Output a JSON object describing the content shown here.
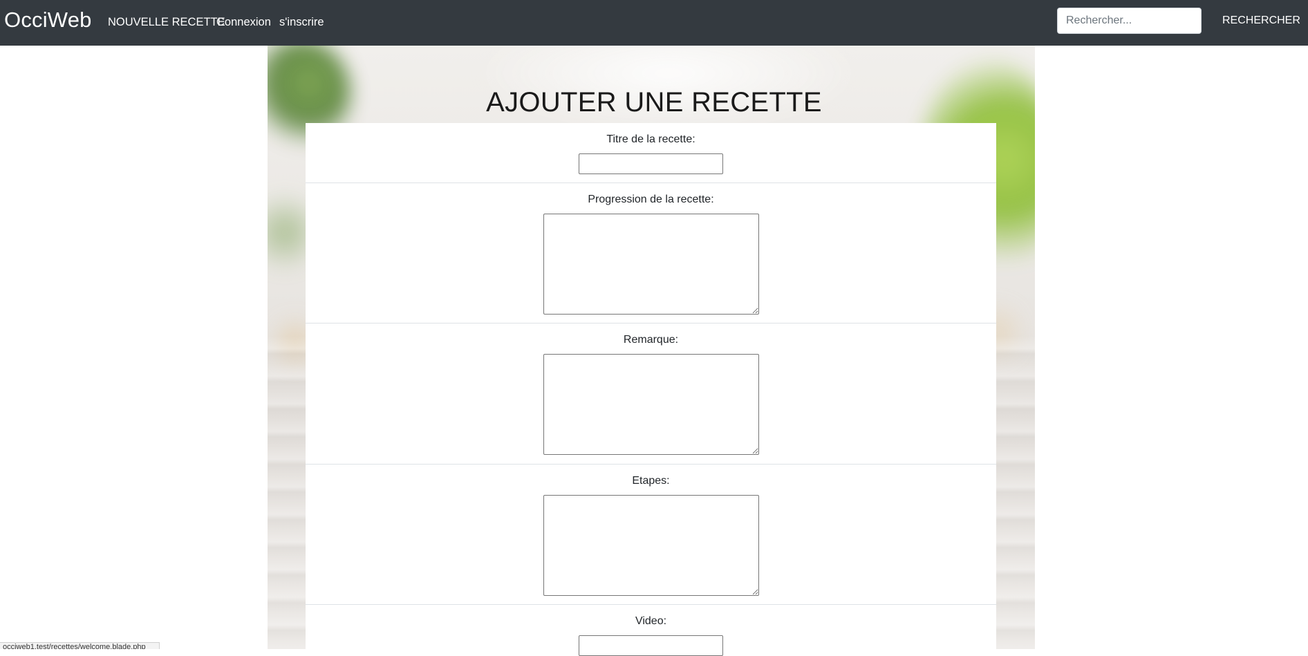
{
  "navbar": {
    "brand": "OcciWeb",
    "links": [
      "NOUVELLE RECETTE",
      "Connexion",
      "s'inscrire"
    ],
    "search": {
      "placeholder": "Rechercher...",
      "value": "",
      "button_label": "RECHERCHER"
    },
    "background_color": "#343a40"
  },
  "page": {
    "title": "AJOUTER UNE RECETTE"
  },
  "form": {
    "fields": [
      {
        "label": "Titre de la recette:",
        "type": "text",
        "value": ""
      },
      {
        "label": "Progression de la recette:",
        "type": "textarea",
        "value": ""
      },
      {
        "label": "Remarque:",
        "type": "textarea",
        "value": ""
      },
      {
        "label": "Etapes:",
        "type": "textarea",
        "value": ""
      },
      {
        "label": "Video:",
        "type": "text",
        "value": ""
      }
    ]
  },
  "status_bar": {
    "url_text": "occiweb1.test/recettes/welcome.blade.php"
  }
}
